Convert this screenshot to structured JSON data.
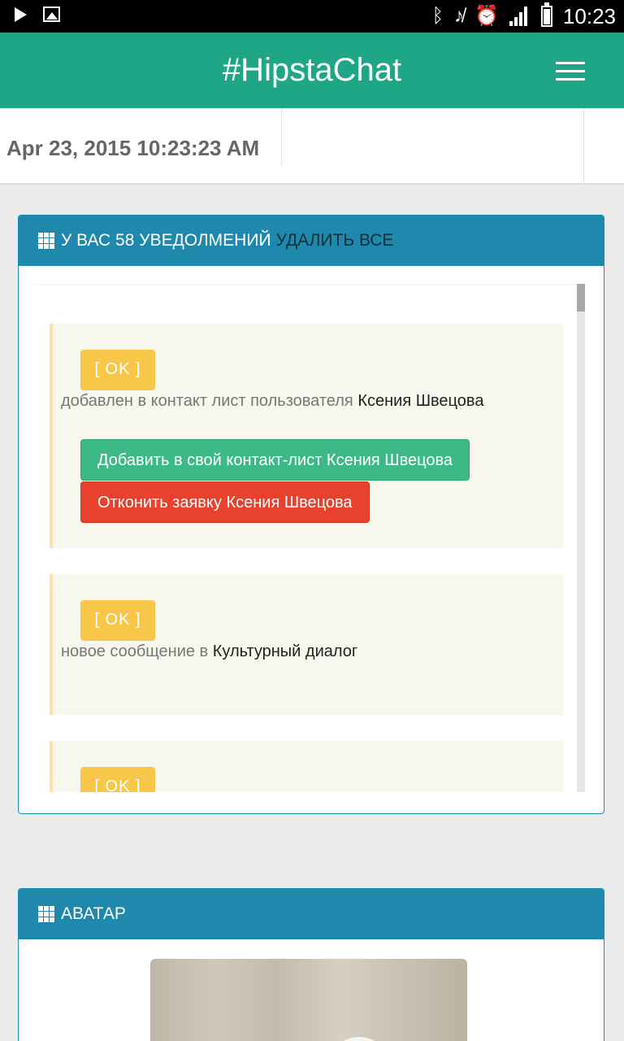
{
  "status_bar": {
    "time": "10:23",
    "icons": [
      "play-icon",
      "gallery-icon",
      "bluetooth-icon",
      "mute-icon",
      "alarm-icon",
      "signal-icon",
      "battery-icon"
    ]
  },
  "app_bar": {
    "title": "#HipstaChat",
    "menu_icon": "hamburger-menu-icon",
    "color": "#1fa687"
  },
  "date_bar": {
    "datetime": "Apr 23, 2015 10:23:23 AM"
  },
  "notifications_panel": {
    "title": "У ВАС 58 УВЕДОЛМЕНИЙ",
    "delete_all": "УДАЛИТЬ ВСЕ",
    "items": [
      {
        "badge": "[ OK ]",
        "text": "добавлен в контакт лист пользователя",
        "subject": "Ксения Швецова",
        "accept_button": "Добавить в свой контакт-лист Ксения Швецова",
        "reject_button": "Отконить заявку Ксения Швецова"
      },
      {
        "badge": "[ OK ]",
        "text": "новое сообщение в",
        "subject": "Культурный диалог"
      },
      {
        "badge": "[ OK ]"
      }
    ]
  },
  "avatar_panel": {
    "title": "АВАТАР"
  },
  "colors": {
    "panel_header": "#1f89ad",
    "ok_badge": "#f8c749",
    "accept": "#3cb986",
    "reject": "#e8412d"
  }
}
